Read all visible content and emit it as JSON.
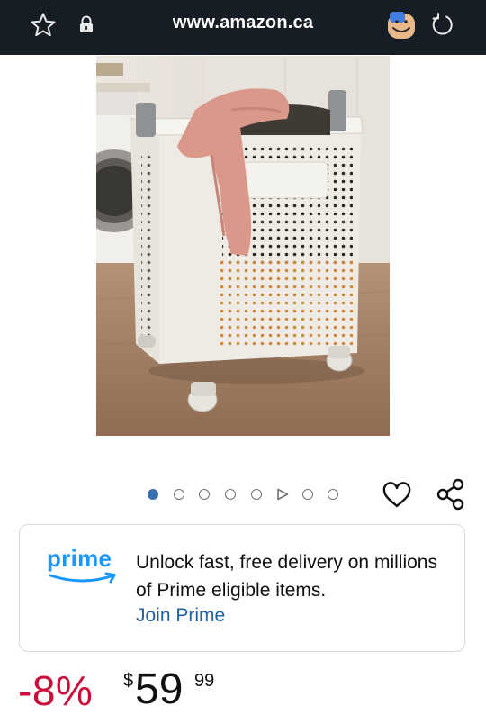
{
  "browser": {
    "url": "www.amazon.ca",
    "icons": {
      "bookmark": "star-icon",
      "security": "lock-icon",
      "profile": "avatar-icon",
      "reload": "reload-icon"
    }
  },
  "product": {
    "image_description_icon": "laundry-basket-image",
    "carousel": {
      "total_items": 8,
      "active_index": 0,
      "video_index": 5
    },
    "actions": {
      "wishlist_icon": "heart-icon",
      "share_icon": "share-icon"
    }
  },
  "prime": {
    "logo_text": "prime",
    "message": "Unlock fast, free delivery on millions of Prime eligible items.",
    "link": "Join Prime"
  },
  "price": {
    "discount": "-8%",
    "currency_symbol": "$",
    "whole": "59",
    "fraction": "99"
  },
  "colors": {
    "topbar_bg": "#161d25",
    "prime_blue": "#1a98ff",
    "link_blue": "#2162a1",
    "discount_red": "#cc0c39",
    "active_dot": "#3a6fb0"
  }
}
